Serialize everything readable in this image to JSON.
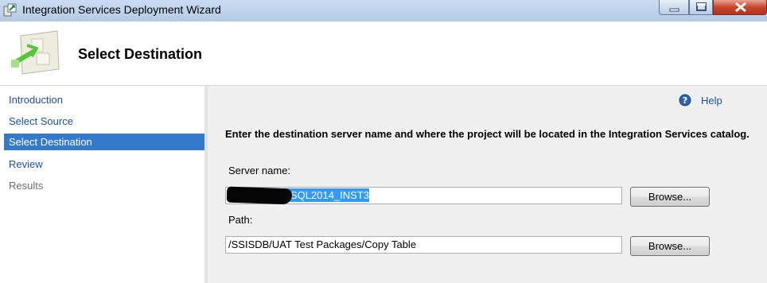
{
  "window": {
    "title": "Integration Services Deployment Wizard"
  },
  "header": {
    "title": "Select Destination",
    "icon": "deployment-wizard-icon"
  },
  "nav": {
    "items": [
      {
        "label": "Introduction",
        "state": "link"
      },
      {
        "label": "Select Source",
        "state": "link"
      },
      {
        "label": "Select Destination",
        "state": "selected"
      },
      {
        "label": "Review",
        "state": "link"
      },
      {
        "label": "Results",
        "state": "disabled"
      }
    ]
  },
  "main": {
    "help_label": "Help",
    "instruction": "Enter the destination server name and where the project will be located in the Integration Services catalog.",
    "server": {
      "label": "Server name:",
      "value": "SQL2014_INST3",
      "browse_label": "Browse..."
    },
    "path": {
      "label": "Path:",
      "value": "/SSISDB/UAT Test Packages/Copy Table",
      "browse_label": "Browse..."
    }
  },
  "colors": {
    "title_bar": "#b4cbe6",
    "nav_selected": "#3379cc",
    "link": "#1e4f9a",
    "panel_bg": "#f0f0f0",
    "text_selection": "#3399ff"
  }
}
